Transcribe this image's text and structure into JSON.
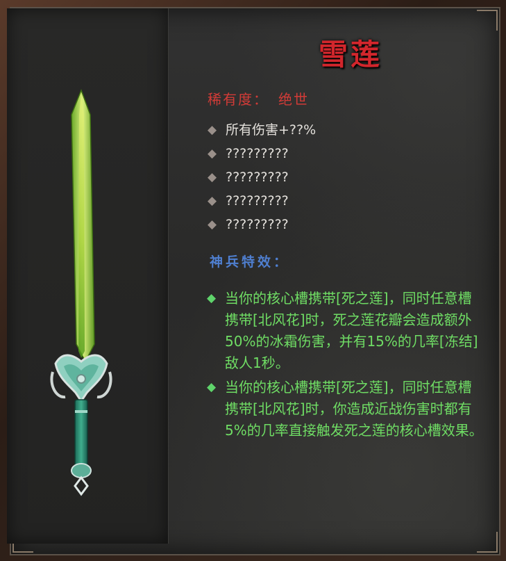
{
  "item": {
    "name": "雪莲",
    "rarity_label": "稀有度：",
    "rarity_value": "绝世"
  },
  "stats": [
    "所有伤害+??%",
    "?????????",
    "?????????",
    "?????????",
    "?????????"
  ],
  "effects_title": "神兵特效：",
  "effects": [
    "当你的核心槽携带[死之莲]，同时任意槽携带[北风花]时，死之莲花瓣会造成额外50%的冰霜伤害，并有15%的几率[冻结]敌人1秒。",
    "当你的核心槽携带[死之莲]，同时任意槽携带[北风花]时，你造成近战伤害时都有5%的几率直接触发死之莲的核心槽效果。"
  ],
  "icons": {
    "stat_bullet": "diamond-icon",
    "effect_bullet": "green-diamond-icon",
    "item_image": "jade-sword"
  },
  "colors": {
    "title": "#d2262c",
    "rarity": "#d23b37",
    "effects_title": "#4f7fd0",
    "effect_text": "#6fdd64",
    "stat_text": "#e4e1dc"
  }
}
